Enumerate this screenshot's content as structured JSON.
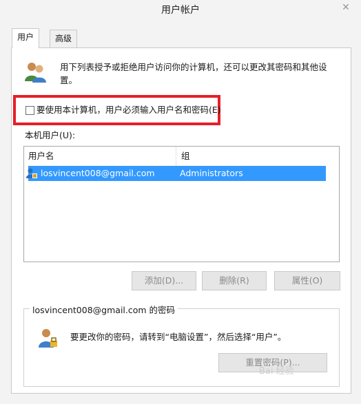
{
  "window": {
    "title": "用户帐户",
    "close_symbol": "✕"
  },
  "tabs": [
    {
      "label": "用户",
      "active": true
    },
    {
      "label": "高级",
      "active": false
    }
  ],
  "intro": {
    "text": "用下列表授予或拒绝用户访问你的计算机，还可以更改其密码和其他设置。"
  },
  "require_login": {
    "label": "要使用本计算机，用户必须输入用户名和密码(E)",
    "checked": false
  },
  "users_list": {
    "label": "本机用户(U):",
    "columns": [
      "用户名",
      "组"
    ],
    "rows": [
      {
        "user": "losvincent008@gmail.com",
        "group": "Administrators",
        "selected": true
      }
    ]
  },
  "buttons": {
    "add": "添加(D)...",
    "remove": "删除(R)",
    "properties": "属性(O)"
  },
  "password_group": {
    "legend": "losvincent008@gmail.com 的密码",
    "text": "要更改你的密码，请转到“电脑设置”，然后选择“用户”。",
    "reset_button": "重置密码(P)..."
  },
  "watermark": "Bai 经验",
  "colors": {
    "selection": "#3399ff",
    "highlight_box": "#e51f2a"
  }
}
